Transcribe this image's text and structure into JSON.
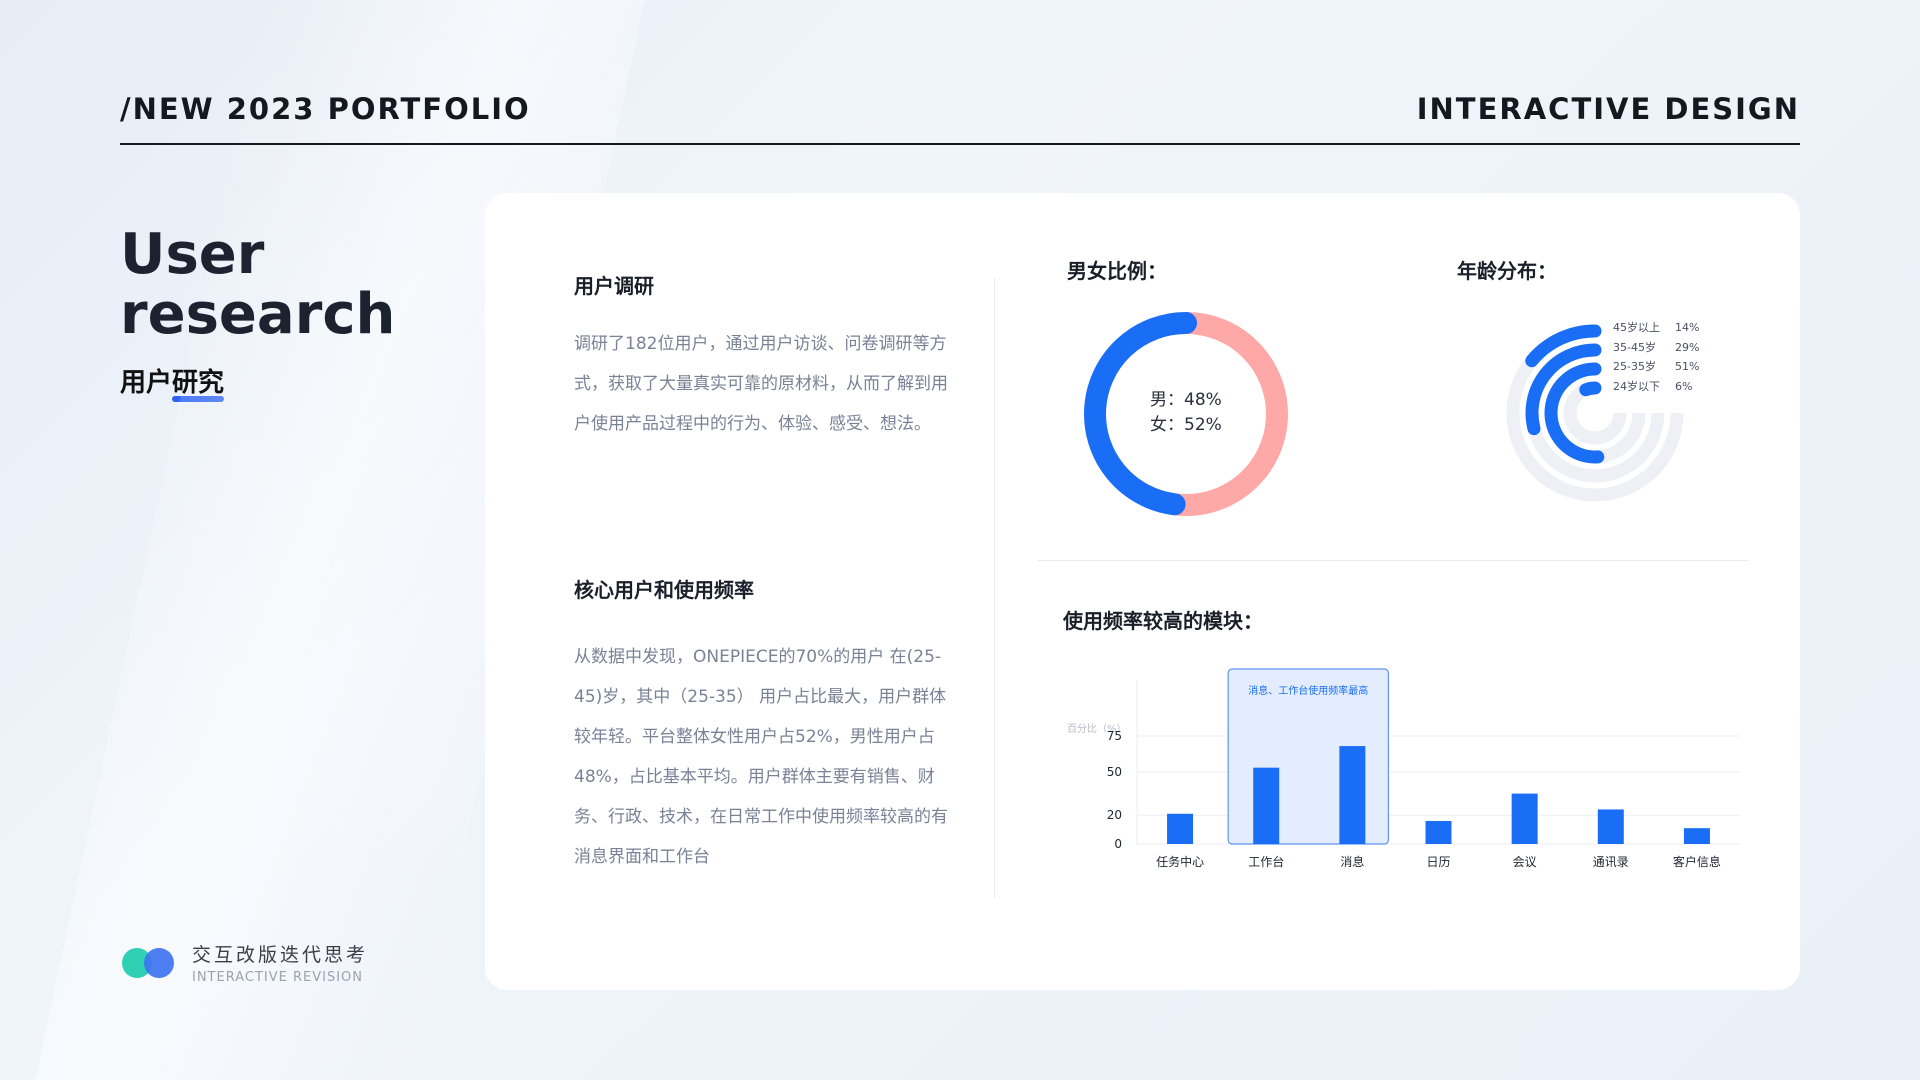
{
  "header": {
    "left": "/NEW 2023 PORTFOLIO",
    "right": "INTERACTIVE DESIGN"
  },
  "hero": {
    "title": "User research",
    "subtitle_prefix": "用户",
    "subtitle_underlined": "研究"
  },
  "brand": {
    "name_cn": "交互改版迭代思考",
    "name_en": "INTERACTIVE REVISION",
    "colors": [
      "#2fd0b4",
      "#3e74f2"
    ]
  },
  "research": {
    "title": "用户调研",
    "text": "调研了182位用户，通过用户访谈、问卷调研等方式，获取了大量真实可靠的原材料，从而了解到用户使用产品过程中的行为、体验、感受、想法。"
  },
  "core": {
    "title": "核心用户和使用频率",
    "text": "从数据中发现，ONEPIECE的70%的用户 在(25-45)岁，其中（25-35） 用户占比最大，用户群体较年轻。平台整体女性用户占52%，男性用户占48%，占比基本平均。用户群体主要有销售、财务、行政、技术，在日常工作中使用频率较高的有消息界面和工作台"
  },
  "gender": {
    "title": "男女比例：",
    "male_label": "男：48%",
    "female_label": "女：52%",
    "male_pct": 48,
    "female_pct": 52,
    "male_color": "#1a6ef5",
    "female_color": "#ffa8a8"
  },
  "age": {
    "title": "年龄分布：",
    "color": "#1a6ef5",
    "track_color": "#eef0f6",
    "items": [
      {
        "label": "45岁以上",
        "pct_text": "14%",
        "pct": 14
      },
      {
        "label": "35-45岁",
        "pct_text": "29%",
        "pct": 29
      },
      {
        "label": "25-35岁",
        "pct_text": "51%",
        "pct": 51
      },
      {
        "label": "24岁以下",
        "pct_text": "6%",
        "pct": 6
      }
    ]
  },
  "usage": {
    "title": "使用频率较高的模块："
  },
  "chart_data": {
    "type": "bar",
    "ylabel": "百分比（%）",
    "yticks": [
      0,
      20,
      50,
      75
    ],
    "ylim": [
      0,
      100
    ],
    "categories": [
      "任务中心",
      "工作台",
      "消息",
      "日历",
      "会议",
      "通讯录",
      "客户信息"
    ],
    "values": [
      21,
      53,
      68,
      16,
      35,
      24,
      11
    ],
    "highlight": {
      "categories": [
        "工作台",
        "消息"
      ],
      "label": "消息、工作台使用频率最高"
    },
    "bar_color": "#1a6ef5",
    "grid": true
  }
}
